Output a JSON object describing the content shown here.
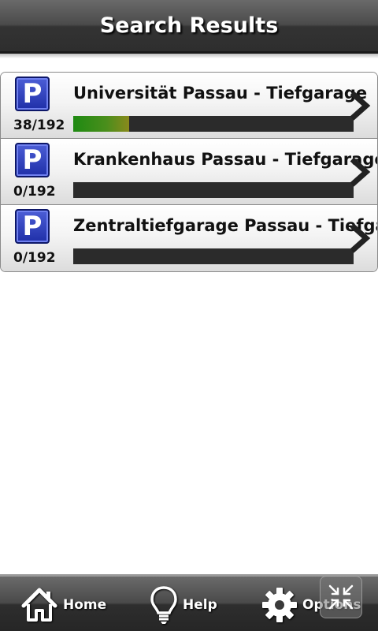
{
  "header": {
    "title": "Search Results"
  },
  "results": [
    {
      "icon": "parking-icon",
      "count": "38/192",
      "name": "Universität Passau - Tiefgarage",
      "occupancy": 0.2
    },
    {
      "icon": "parking-icon",
      "count": "0/192",
      "name": "Krankenhaus Passau - Tiefgarage",
      "occupancy": 0
    },
    {
      "icon": "parking-icon",
      "count": "0/192",
      "name": "Zentraltiefgarage Passau - Tiefgarage",
      "occupancy": 0
    }
  ],
  "footer": {
    "home_label": "Home",
    "help_label": "Help",
    "options_label": "Options"
  },
  "colors": {
    "accent_parking": "#2a3bbd",
    "bar_fill": "#1e8a12",
    "bar_track": "#2b2b2b"
  }
}
